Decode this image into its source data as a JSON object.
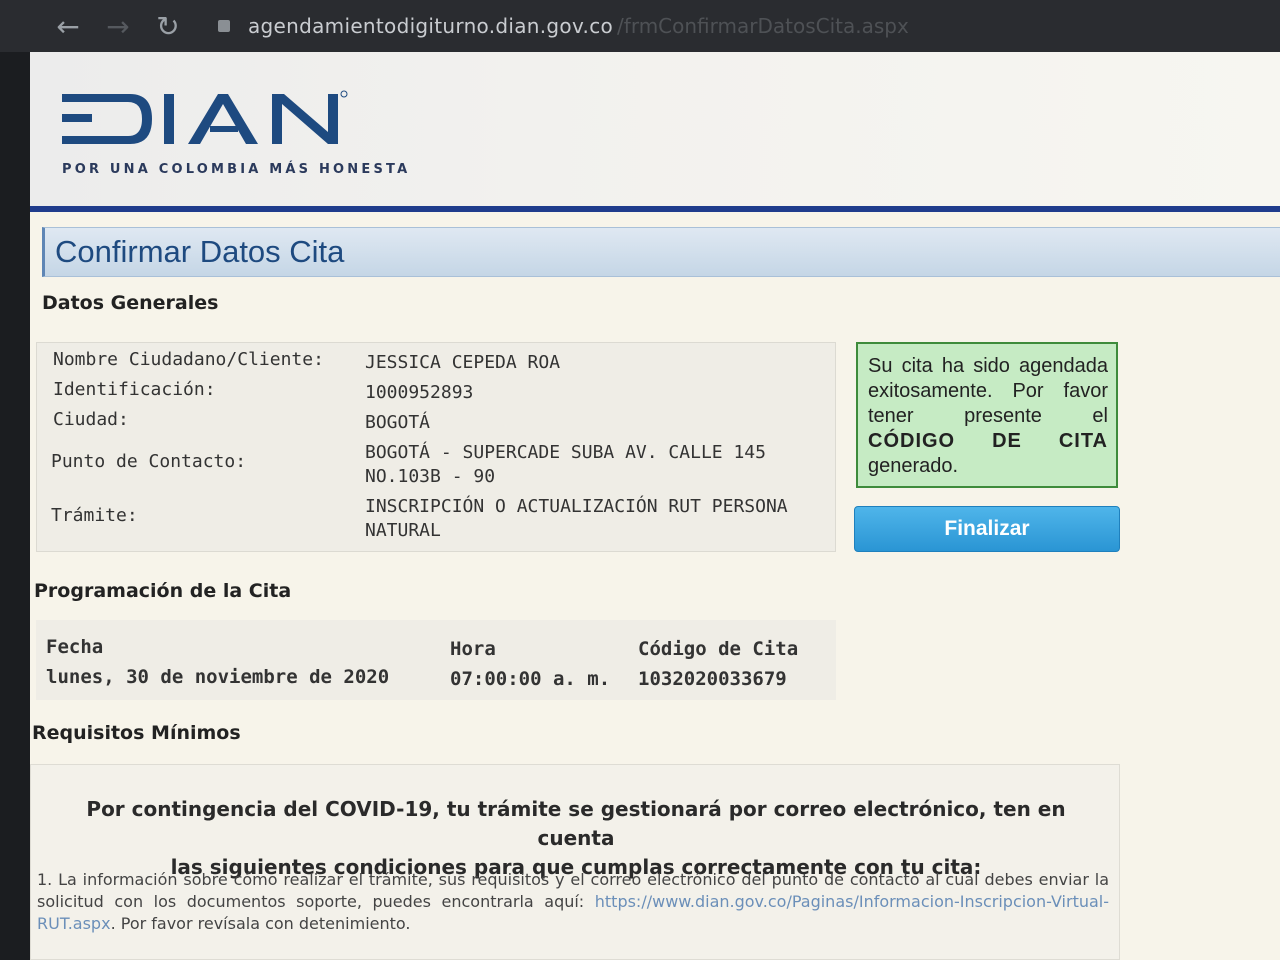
{
  "browser": {
    "url": "agendamientodigiturno.dian.gov.co",
    "url_path": "/frmConfirmarDatosCita.aspx"
  },
  "header": {
    "logo_text": "DIAN",
    "tagline": "POR UNA COLOMBIA MÁS HONESTA"
  },
  "page_title": "Confirmar Datos Cita",
  "general": {
    "heading": "Datos Generales",
    "rows": [
      {
        "label": "Nombre Ciudadano/Cliente:",
        "value": "JESSICA CEPEDA ROA"
      },
      {
        "label": "Identificación:",
        "value": "1000952893"
      },
      {
        "label": "Ciudad:",
        "value": "BOGOTÁ"
      },
      {
        "label": "Punto de Contacto:",
        "value": "BOGOTÁ - SUPERCADE SUBA AV. CALLE 145 NO.103B - 90"
      },
      {
        "label": "Trámite:",
        "value": "INSCRIPCIÓN O ACTUALIZACIÓN RUT PERSONA NATURAL"
      }
    ]
  },
  "notice": {
    "text_before": "Su cita ha sido agendada exitosamente. Por favor tener presente el",
    "text_bold": "CÓDIGO DE CITA",
    "text_after": "generado."
  },
  "finalize_label": "Finalizar",
  "schedule": {
    "heading": "Programación de la Cita",
    "fecha_label": "Fecha",
    "fecha_value": "lunes, 30 de noviembre de 2020",
    "hora_label": "Hora",
    "hora_value": "07:00:00 a. m.",
    "codigo_label": "Código de Cita",
    "codigo_value": "1032020033679"
  },
  "requirements": {
    "heading": "Requisitos Mínimos",
    "covid_line1": "Por contingencia del COVID-19, tu trámite se gestionará por correo electrónico, ten en cuenta",
    "covid_line2": "las siguientes condiciones para que cumplas correctamente con tu cita:",
    "item1_text": "1. La información sobre cómo realizar el trámite, sus requisitos y el correo electrónico del punto de contacto al cual debes enviar la solicitud con los documentos soporte, puedes encontrarla aquí:",
    "item1_link": "https://www.dian.gov.co/Paginas/Informacion-Inscripcion-Virtual-RUT.aspx",
    "item1_after": ". Por favor revísala con detenimiento."
  }
}
